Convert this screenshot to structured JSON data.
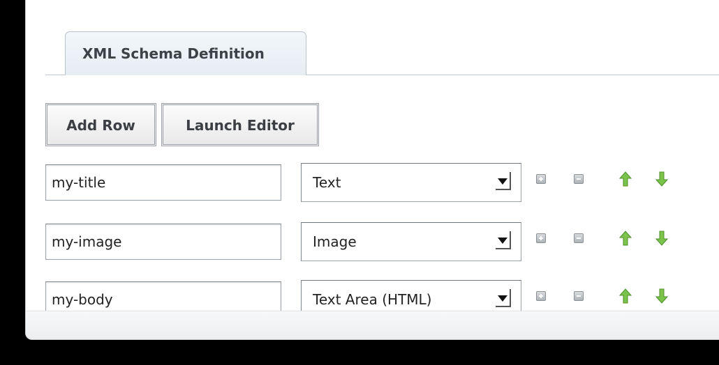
{
  "tab": {
    "label": "XML Schema Definition"
  },
  "toolbar": {
    "add_row_label": "Add Row",
    "launch_editor_label": "Launch Editor"
  },
  "rows": [
    {
      "name": "my-title",
      "type": "Text"
    },
    {
      "name": "my-image",
      "type": "Image"
    },
    {
      "name": "my-body",
      "type": "Text Area (HTML)"
    }
  ],
  "icons": {
    "add": "plus-square-icon",
    "remove": "minus-square-icon",
    "move_up": "green-arrow-up-icon",
    "move_down": "green-arrow-down-icon"
  },
  "colors": {
    "arrow_green": "#6dbb3f",
    "tab_bg": "#e6edf3",
    "button_border": "#9aa0a6"
  }
}
